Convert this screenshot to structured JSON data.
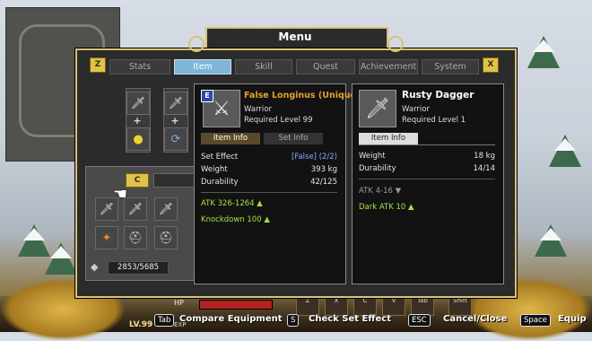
{
  "menu": {
    "title": "Menu",
    "left_key": "Z",
    "right_key": "X",
    "tabs": [
      {
        "label": "Stats",
        "active": false
      },
      {
        "label": "Item",
        "active": true
      },
      {
        "label": "Skill",
        "active": false
      },
      {
        "label": "Quest",
        "active": false
      },
      {
        "label": "Achievement",
        "active": false
      },
      {
        "label": "System",
        "active": false
      }
    ]
  },
  "inventory": {
    "category_key": "C",
    "gold": "2853/5685"
  },
  "equipped_item": {
    "badge": "E",
    "name": "False Longinus (Unique)",
    "name_color": "#e8a030",
    "class": "Warrior",
    "required_level": "Required Level 99",
    "subtabs": [
      "Item Info",
      "Set Info"
    ],
    "stats": [
      {
        "label": "Set Effect",
        "value": "[False] (2/2)"
      },
      {
        "label": "Weight",
        "value": "393 kg"
      },
      {
        "label": "Durability",
        "value": "42/125"
      }
    ],
    "bonuses": [
      "ATK 326-1264 ▲",
      "Knockdown 100 ▲"
    ]
  },
  "compared_item": {
    "name": "Rusty Dagger",
    "class": "Warrior",
    "required_level": "Required Level 1",
    "subtab": "Item Info",
    "stats": [
      {
        "label": "Weight",
        "value": "18 kg"
      },
      {
        "label": "Durability",
        "value": "14/14"
      }
    ],
    "bonuses_down": "ATK 4-16 ▼",
    "bonuses_up": "Dark ATK 10 ▲"
  },
  "hud": {
    "hp_label": "HP",
    "level": "LV.99",
    "exp_label": "EXP",
    "skill_keys": [
      "Z",
      "X",
      "C",
      "V",
      "Tab",
      "Shift"
    ]
  },
  "hints": [
    {
      "key": "Tab",
      "label": "Compare Equipment"
    },
    {
      "key": "S",
      "label": "Check Set Effect"
    },
    {
      "key": "ESC",
      "label": "Cancel/Close"
    },
    {
      "key": "Space",
      "label": "Equip"
    }
  ],
  "colors": {
    "gold_border": "#d8c27a",
    "active_tab": "#7fb6d8",
    "unique_orange": "#e8a030",
    "bonus_green": "#a6e04a",
    "set_blue": "#7fb0ff"
  },
  "icons": {
    "equipped_item_icon": "spear-icon",
    "compared_item_icon": "dagger-icon"
  }
}
